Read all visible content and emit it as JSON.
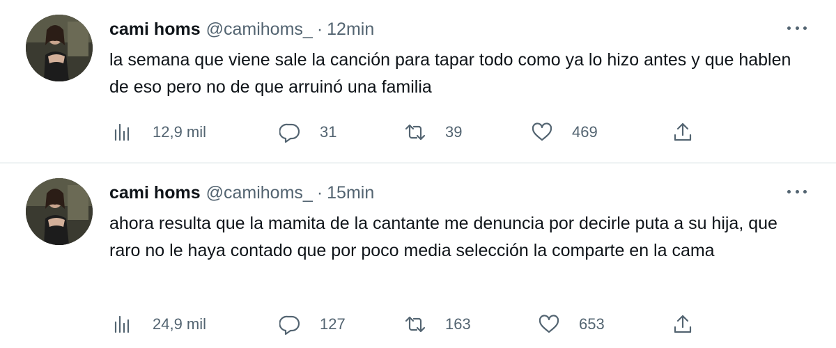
{
  "tweets": [
    {
      "author_name": "cami homs",
      "handle": "@camihoms_",
      "separator": "·",
      "time": "12min",
      "text": "la semana que viene sale la canción para tapar todo como ya lo hizo antes y que hablen de eso pero no de que arruinó una familia",
      "views": "12,9 mil",
      "replies": "31",
      "retweets": "39",
      "likes": "469"
    },
    {
      "author_name": "cami homs",
      "handle": "@camihoms_",
      "separator": "·",
      "time": "15min",
      "text": "ahora resulta que la mamita de la cantante me denuncia por decirle puta a su hija, que raro no le haya contado que por poco media selección la comparte en la cama",
      "views": "24,9 mil",
      "replies": "127",
      "retweets": "163",
      "likes": "653"
    }
  ],
  "icons": {
    "views": "views-chart-icon",
    "reply": "reply-bubble-icon",
    "retweet": "retweet-icon",
    "like": "heart-icon",
    "share": "share-upload-icon",
    "more": "more-dots-icon"
  },
  "colors": {
    "text_primary": "#0f1419",
    "text_secondary": "#536471",
    "divider": "#eff3f4"
  }
}
